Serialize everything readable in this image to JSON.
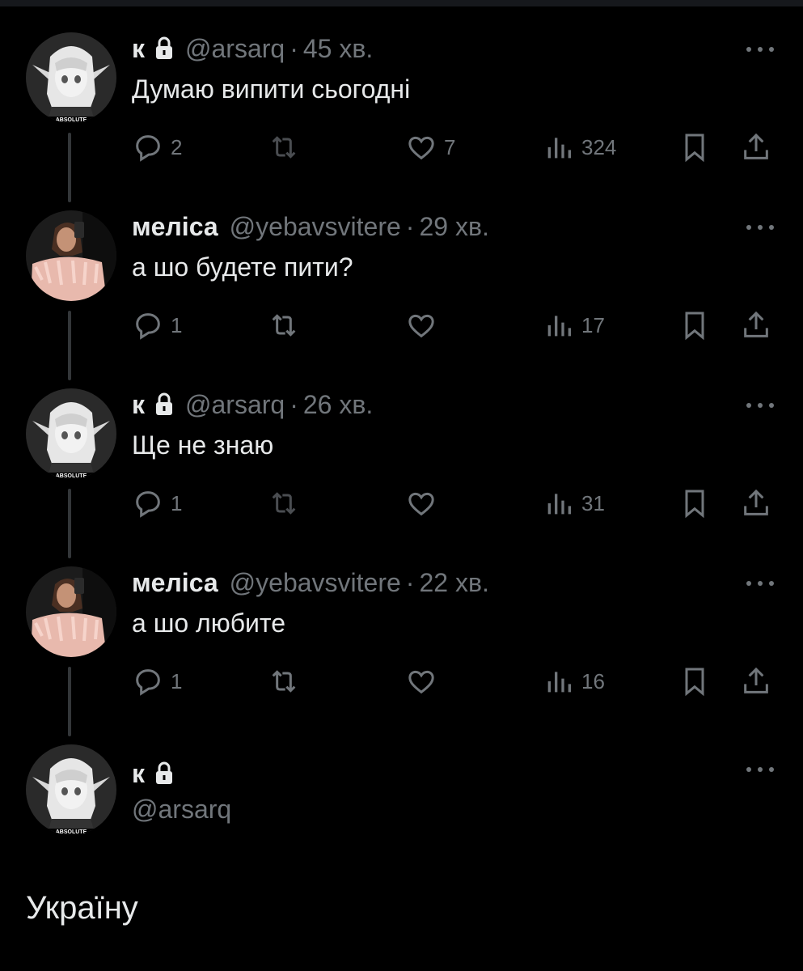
{
  "tweets": [
    {
      "name": "к",
      "handle": "@arsarq",
      "time": "45 хв.",
      "text": "Думаю випити сьогодні",
      "avatar": "anime-girl",
      "replies": "2",
      "retweets": "",
      "likes": "7",
      "views": "324"
    },
    {
      "name": "меліса",
      "handle": "@yebavsvitere",
      "time": "29 хв.",
      "text": "а шо будете пити?",
      "avatar": "woman-photo",
      "replies": "1",
      "retweets": "",
      "likes": "",
      "views": "17"
    },
    {
      "name": "к",
      "handle": "@arsarq",
      "time": "26 хв.",
      "text": "Ще не знаю",
      "avatar": "anime-girl",
      "replies": "1",
      "retweets": "",
      "likes": "",
      "views": "31"
    },
    {
      "name": "меліса",
      "handle": "@yebavsvitere",
      "time": "22 хв.",
      "text": "а шо любите",
      "avatar": "woman-photo",
      "replies": "1",
      "retweets": "",
      "likes": "",
      "views": "16"
    }
  ],
  "compose": {
    "name": "к",
    "handle": "@arsarq",
    "text": "Україну"
  },
  "separator": "·",
  "avatar_badge": "ABSOLUTE",
  "colors": {
    "background": "#000000",
    "text": "#e7e9ea",
    "muted": "#71767b",
    "line": "#333639"
  }
}
